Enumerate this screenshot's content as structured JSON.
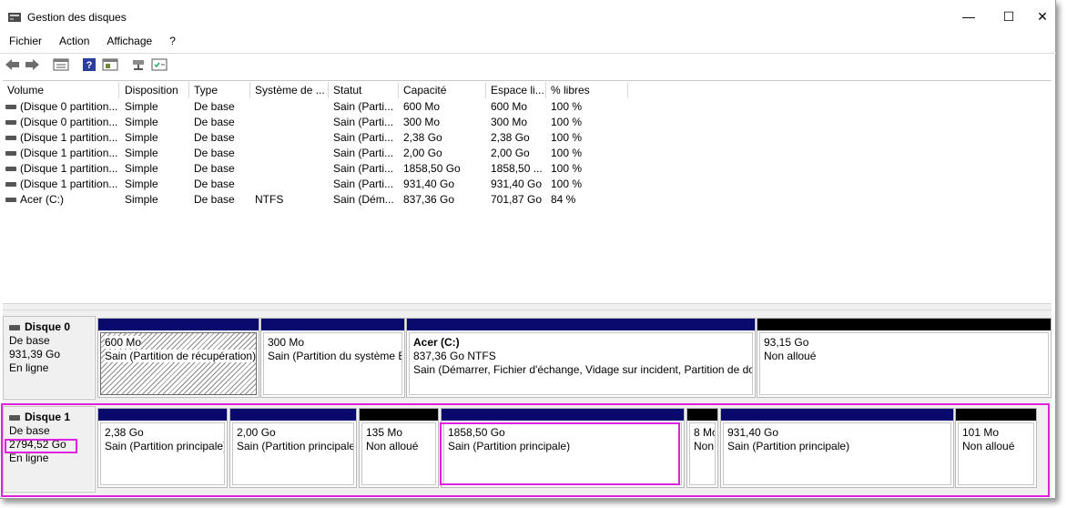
{
  "window": {
    "title": "Gestion des disques",
    "minimize": "—",
    "maximize": "☐",
    "close": "✕"
  },
  "menu": {
    "items": [
      "Fichier",
      "Action",
      "Affichage",
      "?"
    ]
  },
  "toolbar": {
    "buttons": [
      "back-icon",
      "forward-icon",
      "list-view-icon",
      "help-icon",
      "properties-icon",
      "connect-icon",
      "checklist-icon"
    ]
  },
  "volumes": {
    "columns": [
      "Volume",
      "Disposition",
      "Type",
      "Système de ...",
      "Statut",
      "Capacité",
      "Espace li...",
      "% libres"
    ],
    "rows": [
      [
        "(Disque 0 partition...",
        "Simple",
        "De base",
        "",
        "Sain (Parti...",
        "600 Mo",
        "600 Mo",
        "100 %"
      ],
      [
        "(Disque 0 partition...",
        "Simple",
        "De base",
        "",
        "Sain (Parti...",
        "300 Mo",
        "300 Mo",
        "100 %"
      ],
      [
        "(Disque 1 partition...",
        "Simple",
        "De base",
        "",
        "Sain (Parti...",
        "2,38 Go",
        "2,38 Go",
        "100 %"
      ],
      [
        "(Disque 1 partition...",
        "Simple",
        "De base",
        "",
        "Sain (Parti...",
        "2,00 Go",
        "2,00 Go",
        "100 %"
      ],
      [
        "(Disque 1 partition...",
        "Simple",
        "De base",
        "",
        "Sain (Parti...",
        "1858,50 Go",
        "1858,50 ...",
        "100 %"
      ],
      [
        "(Disque 1 partition...",
        "Simple",
        "De base",
        "",
        "Sain (Parti...",
        "931,40 Go",
        "931,40 Go",
        "100 %"
      ],
      [
        "Acer (C:)",
        "Simple",
        "De base",
        "NTFS",
        "Sain (Dém...",
        "837,36 Go",
        "701,87 Go",
        "84 %"
      ]
    ]
  },
  "disks": [
    {
      "name": "Disque 0",
      "type": "De base",
      "size": "931,39 Go",
      "status": "En ligne",
      "partitions": [
        {
          "size": "600 Mo",
          "status": "Sain (Partition de récupération)",
          "bar": "#0a0a6e",
          "hatched": true
        },
        {
          "size": "300 Mo",
          "status": "Sain (Partition du système EFI)",
          "bar": "#0a0a6e"
        },
        {
          "label": "Acer  (C:)",
          "size": "837,36 Go NTFS",
          "status": "Sain (Démarrer, Fichier d'échange, Vidage sur incident, Partition de données de base)",
          "bar": "#0a0a6e"
        },
        {
          "size": "93,15 Go",
          "status": "Non alloué",
          "bar": "#000000"
        }
      ]
    },
    {
      "name": "Disque 1",
      "type": "De base",
      "size": "2794,52 Go",
      "status": "En ligne",
      "partitions": [
        {
          "size": "2,38 Go",
          "status": "Sain (Partition principale)",
          "bar": "#0a0a6e"
        },
        {
          "size": "2,00 Go",
          "status": "Sain (Partition principale)",
          "bar": "#0a0a6e"
        },
        {
          "size": "135 Mo",
          "status": "Non alloué",
          "bar": "#000000"
        },
        {
          "size": "1858,50 Go",
          "status": "Sain (Partition principale)",
          "bar": "#0a0a6e"
        },
        {
          "size": "8 Mo",
          "status": "Non alloué",
          "bar": "#000000"
        },
        {
          "size": "931,40 Go",
          "status": "Sain (Partition principale)",
          "bar": "#0a0a6e"
        },
        {
          "size": "101 Mo",
          "status": "Non alloué",
          "bar": "#000000"
        }
      ]
    }
  ],
  "colors": {
    "primary_partition": "#0a0a6e",
    "unallocated": "#000000",
    "highlight": "#e020e0"
  }
}
